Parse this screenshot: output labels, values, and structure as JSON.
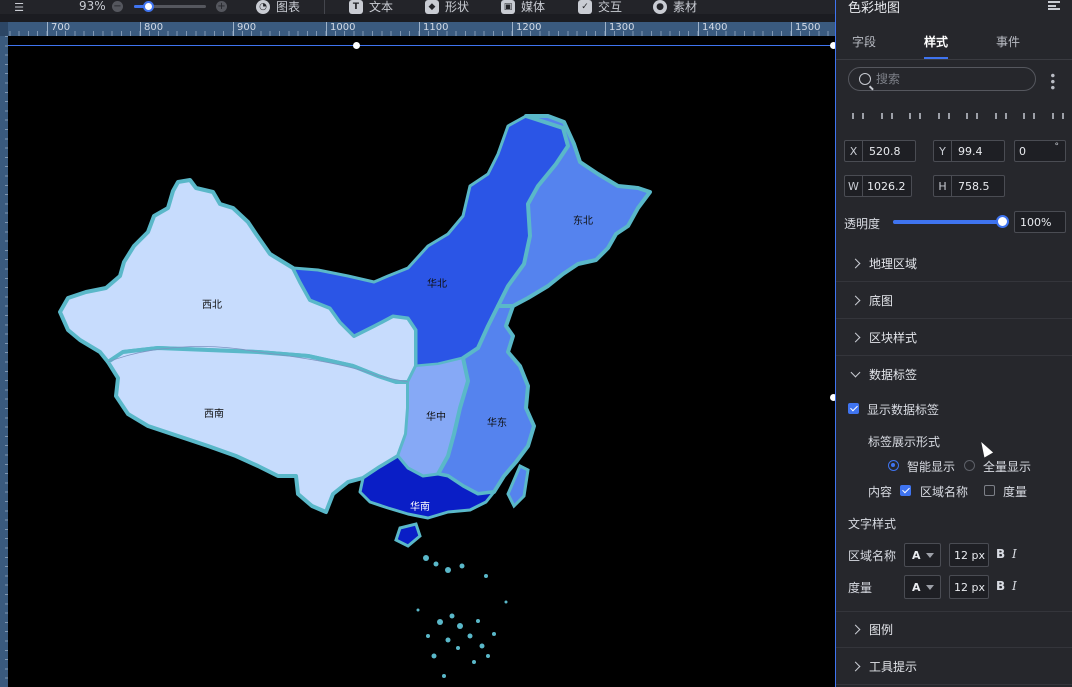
{
  "toolbar": {
    "zoom": "93%",
    "zoom_fraction": 0.2,
    "items": [
      {
        "label": "图表",
        "icon": "chart-icon"
      },
      {
        "label": "文本",
        "icon": "text-icon"
      },
      {
        "label": "形状",
        "icon": "shape-icon"
      },
      {
        "label": "媒体",
        "icon": "media-icon"
      },
      {
        "label": "交互",
        "icon": "interaction-icon"
      },
      {
        "label": "素材",
        "icon": "material-icon"
      }
    ]
  },
  "ruler": {
    "labels": [
      "700",
      "800",
      "900",
      "1000",
      "1100",
      "1200",
      "1300",
      "1400",
      "1500"
    ]
  },
  "map": {
    "regions": [
      {
        "name": "西北",
        "color": "#c7dcfd"
      },
      {
        "name": "西南",
        "color": "#c7dcfd"
      },
      {
        "name": "华北",
        "color": "#2b55e6"
      },
      {
        "name": "东北",
        "color": "#5583ee"
      },
      {
        "name": "华中",
        "color": "#86a9f6"
      },
      {
        "name": "华东",
        "color": "#5583ee"
      },
      {
        "name": "华南",
        "color": "#0a1ec6"
      }
    ],
    "border_color": "#5ab8c9"
  },
  "panel": {
    "title": "色彩地图",
    "tabs": [
      {
        "label": "字段",
        "active": false
      },
      {
        "label": "样式",
        "active": true
      },
      {
        "label": "事件",
        "active": false
      }
    ],
    "search_placeholder": "搜索",
    "position": {
      "x_label": "X",
      "x": "520.8",
      "y_label": "Y",
      "y": "99.4",
      "rotation": "0",
      "rotation_unit": "°",
      "w_label": "W",
      "w": "1026.2",
      "h_label": "H",
      "h": "758.5"
    },
    "opacity_label": "透明度",
    "opacity_value": "100%",
    "opacity_fraction": 1.0,
    "sections": {
      "geo": "地理区域",
      "base_map": "底图",
      "block_style": "区块样式",
      "data_label": "数据标签",
      "legend": "图例",
      "tooltip": "工具提示"
    },
    "data_label": {
      "show_label": "显示数据标签",
      "show_checked": true,
      "display_form_label": "标签展示形式",
      "smart_display": "智能显示",
      "full_display": "全量显示",
      "content_label": "内容",
      "region_name": "区域名称",
      "region_name_checked": true,
      "measure": "度量",
      "measure_checked": false
    },
    "text_style": {
      "title": "文字样式",
      "rows": [
        {
          "label": "区域名称",
          "color_glyph": "A",
          "size": "12 px",
          "bold": "B",
          "italic": "I"
        },
        {
          "label": "度量",
          "color_glyph": "A",
          "size": "12 px",
          "bold": "B",
          "italic": "I"
        }
      ]
    }
  }
}
